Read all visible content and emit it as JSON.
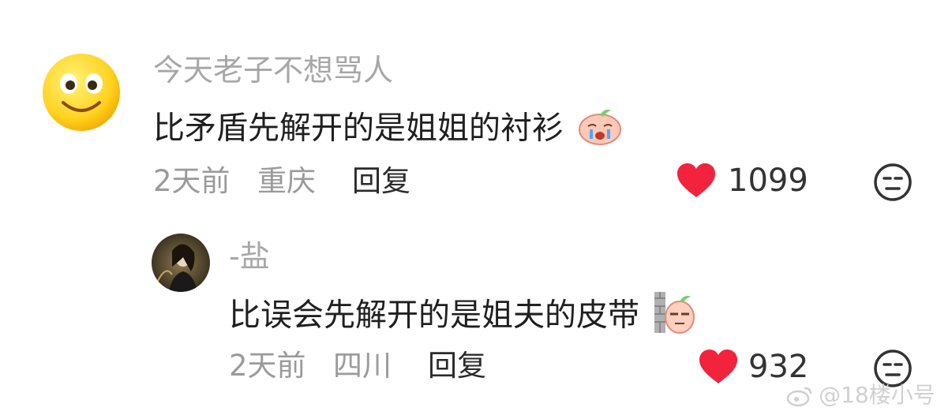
{
  "comments": [
    {
      "username": "今天老子不想骂人",
      "text": "比矛盾先解开的是姐姐的衬衫",
      "time": "2天前",
      "location": "重庆",
      "reply_label": "回复",
      "likes": "1099"
    },
    {
      "username": "-盐",
      "text": "比误会先解开的是姐夫的皮带",
      "time": "2天前",
      "location": "四川",
      "reply_label": "回复",
      "likes": "932"
    }
  ],
  "watermark": "@18楼小号",
  "colors": {
    "heart": "#f2233c",
    "meta": "#9a9a9a",
    "username": "#a7a7a7"
  }
}
